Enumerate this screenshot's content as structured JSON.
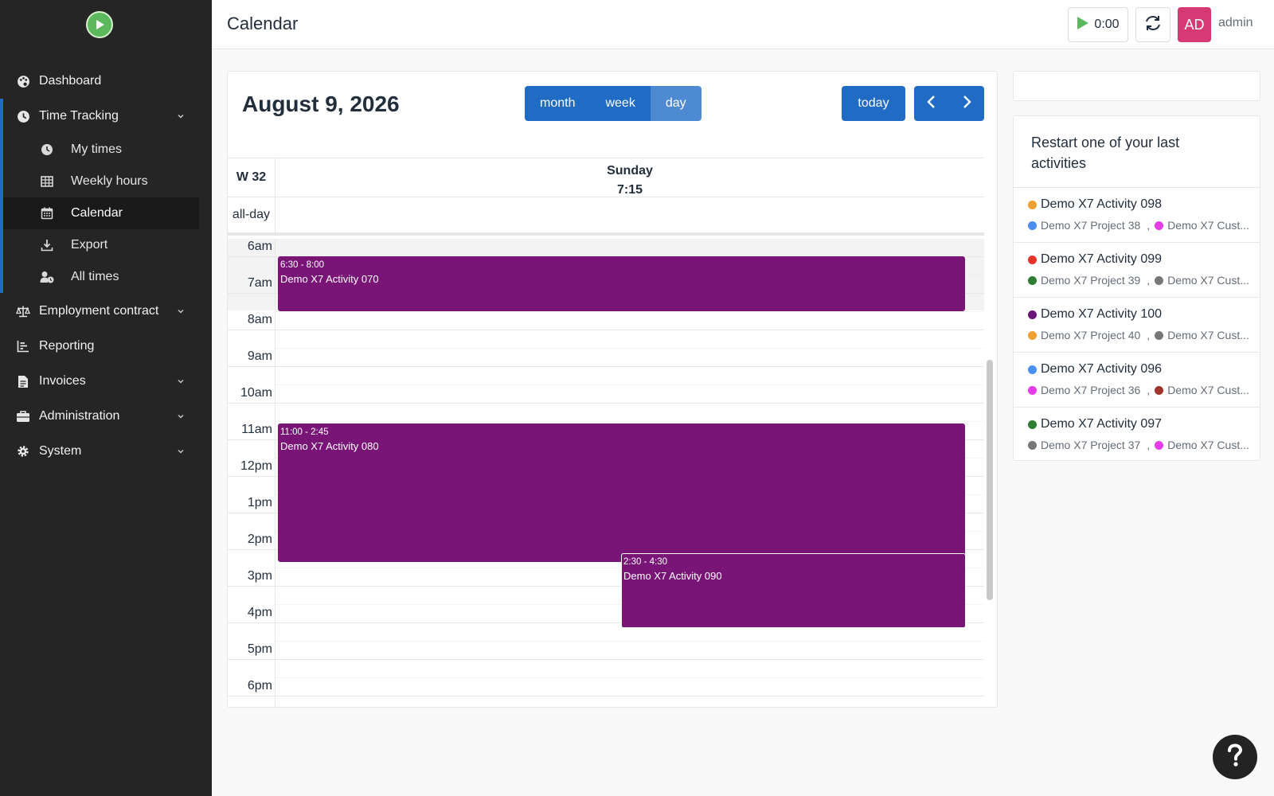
{
  "sidebar": {
    "logo_icon": "play-circle-icon",
    "items": [
      {
        "label": "Dashboard",
        "icon": "palette-icon"
      },
      {
        "label": "Time Tracking",
        "icon": "clock-icon",
        "expanded": true
      },
      {
        "label": "Employment contract",
        "icon": "scale-icon"
      },
      {
        "label": "Reporting",
        "icon": "bar-chart-icon"
      },
      {
        "label": "Invoices",
        "icon": "invoice-icon"
      },
      {
        "label": "Administration",
        "icon": "briefcase-icon"
      },
      {
        "label": "System",
        "icon": "gear-icon"
      }
    ],
    "sub_items": [
      {
        "label": "My times",
        "icon": "clock-icon"
      },
      {
        "label": "Weekly hours",
        "icon": "table-icon"
      },
      {
        "label": "Calendar",
        "icon": "calendar-icon",
        "active": true
      },
      {
        "label": "Export",
        "icon": "download-icon"
      },
      {
        "label": "All times",
        "icon": "user-clock-icon"
      }
    ]
  },
  "header": {
    "title": "Calendar",
    "timer": "0:00",
    "avatar_initials": "AD",
    "username": "admin"
  },
  "calendar": {
    "title": "August 9, 2026",
    "views": [
      "month",
      "week",
      "day"
    ],
    "active_view": "day",
    "today_label": "today",
    "week_label": "W 32",
    "day_name": "Sunday",
    "day_duration": "7:15",
    "allday_label": "all-day",
    "hours": [
      "6am",
      "7am",
      "8am",
      "9am",
      "10am",
      "11am",
      "12pm",
      "1pm",
      "2pm",
      "3pm",
      "4pm",
      "5pm",
      "6pm"
    ],
    "events": [
      {
        "time": "6:30 - 8:00",
        "title": "Demo X7 Activity 070",
        "color": "#7a1578"
      },
      {
        "time": "11:00 - 2:45",
        "title": "Demo X7 Activity 080",
        "color": "#7a1578"
      },
      {
        "time": "2:30 - 4:30",
        "title": "Demo X7 Activity 090",
        "color": "#7a1578"
      }
    ]
  },
  "recent": {
    "title": "Restart one of your last activities",
    "items": [
      {
        "activity": "Demo X7 Activity 098",
        "activity_color": "#f0a030",
        "project": "Demo X7 Project 38",
        "project_color": "#4a8ef0",
        "customer": "Demo X7 Cust...",
        "customer_color": "#e53be8"
      },
      {
        "activity": "Demo X7 Activity 099",
        "activity_color": "#e6332a",
        "project": "Demo X7 Project 39",
        "project_color": "#2e7d32",
        "customer": "Demo X7 Cust...",
        "customer_color": "#777777"
      },
      {
        "activity": "Demo X7 Activity 100",
        "activity_color": "#6a1577",
        "project": "Demo X7 Project 40",
        "project_color": "#f0a030",
        "customer": "Demo X7 Cust...",
        "customer_color": "#777777"
      },
      {
        "activity": "Demo X7 Activity 096",
        "activity_color": "#4a8ef0",
        "project": "Demo X7 Project 36",
        "project_color": "#e53be8",
        "customer": "Demo X7 Cust...",
        "customer_color": "#a0352c"
      },
      {
        "activity": "Demo X7 Activity 097",
        "activity_color": "#2e7d32",
        "project": "Demo X7 Project 37",
        "project_color": "#777777",
        "customer": "Demo X7 Cust...",
        "customer_color": "#e53be8"
      }
    ]
  },
  "help_icon": "question-icon"
}
